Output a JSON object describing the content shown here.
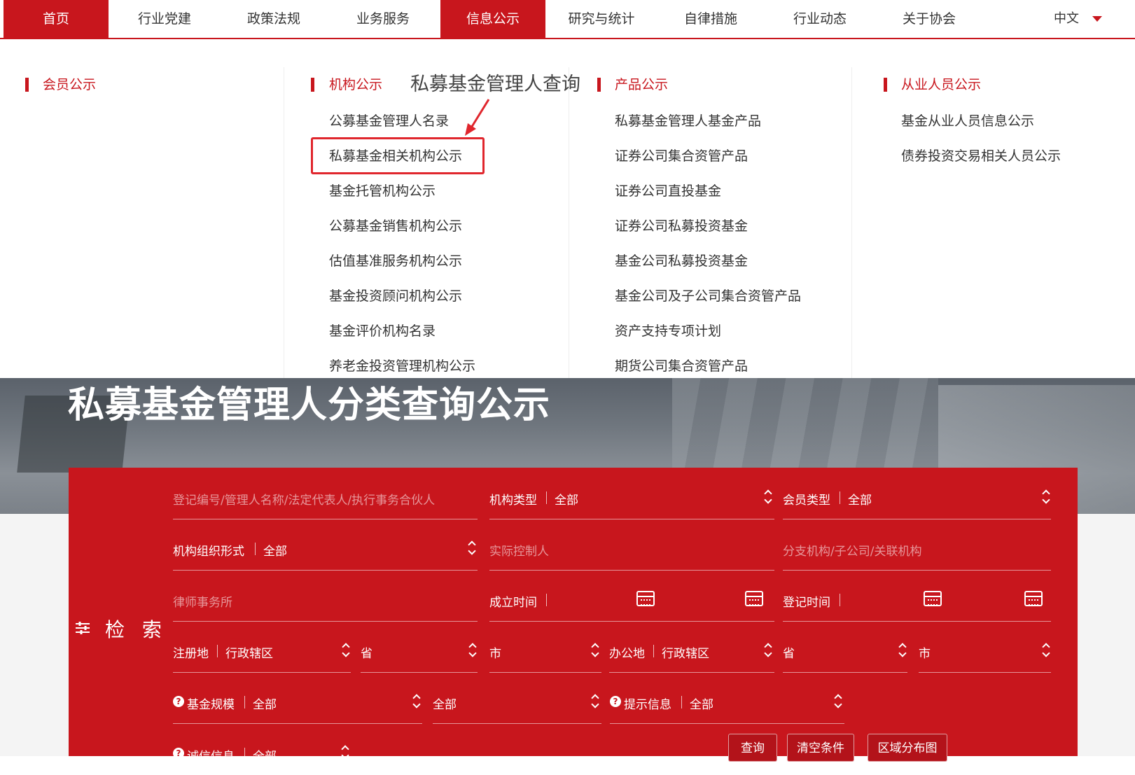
{
  "nav": {
    "items": [
      "首页",
      "行业党建",
      "政策法规",
      "业务服务",
      "信息公示",
      "研究与统计",
      "自律措施",
      "行业动态",
      "关于协会"
    ],
    "lang": "中文"
  },
  "menu": {
    "annotation": "私募基金管理人查询",
    "cols": [
      {
        "title": "会员公示",
        "links": []
      },
      {
        "title": "机构公示",
        "links": [
          "公募基金管理人名录",
          "私募基金相关机构公示",
          "基金托管机构公示",
          "公募基金销售机构公示",
          "估值基准服务机构公示",
          "基金投资顾问机构公示",
          "基金评价机构名录",
          "养老金投资管理机构公示"
        ]
      },
      {
        "title": "产品公示",
        "links": [
          "私募基金管理人基金产品",
          "证券公司集合资管产品",
          "证券公司直投基金",
          "证券公司私募投资基金",
          "基金公司私募投资基金",
          "基金公司及子公司集合资管产品",
          "资产支持专项计划",
          "期货公司集合资管产品"
        ]
      },
      {
        "title": "从业人员公示",
        "links": [
          "基金从业人员信息公示",
          "债券投资交易相关人员公示"
        ]
      }
    ]
  },
  "hero": {
    "title": "私募基金管理人分类查询公示"
  },
  "search": {
    "label": "检 索",
    "keyword_placeholder": "登记编号/管理人名称/法定代表人/执行事务合伙人",
    "org_type": {
      "label": "机构类型",
      "value": "全部"
    },
    "member_type": {
      "label": "会员类型",
      "value": "全部"
    },
    "org_form": {
      "label": "机构组织形式",
      "value": "全部"
    },
    "controller_placeholder": "实际控制人",
    "branch_placeholder": "分支机构/子公司/关联机构",
    "law_firm_placeholder": "律师事务所",
    "found_time": {
      "label": "成立时间"
    },
    "reg_time": {
      "label": "登记时间"
    },
    "reg_place": {
      "label": "注册地",
      "district": "行政辖区",
      "province": "省",
      "city": "市"
    },
    "office_place": {
      "label": "办公地",
      "district": "行政辖区",
      "province": "省",
      "city": "市"
    },
    "fund_scale": {
      "label": "基金规模",
      "value1": "全部",
      "value2": "全部"
    },
    "hint_info": {
      "label": "提示信息",
      "value": "全部"
    },
    "credit_info": {
      "label": "诚信信息",
      "value": "全部"
    },
    "buttons": {
      "query": "查询",
      "clear": "清空条件",
      "map": "区域分布图"
    }
  },
  "colors": {
    "brand": "#c8161d",
    "highlight_box": "#e0262d"
  }
}
